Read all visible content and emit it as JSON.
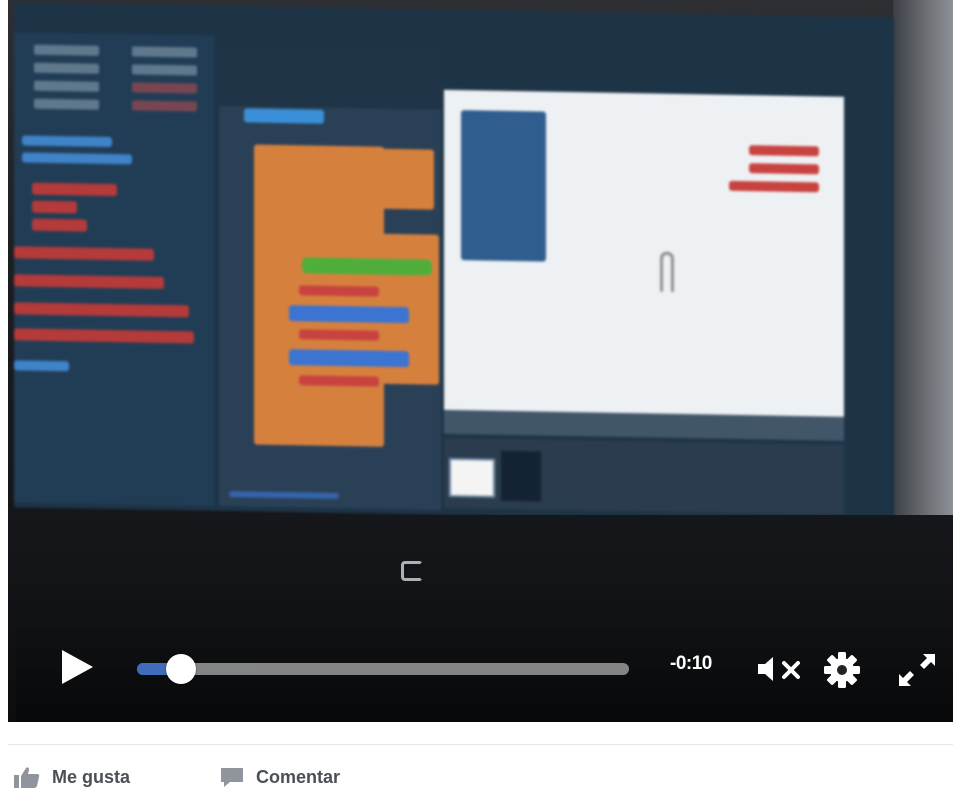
{
  "player": {
    "time_remaining": "-0:10",
    "progress_fraction": 0.09,
    "state": "paused",
    "muted": true
  },
  "actions": {
    "like_label": "Me gusta",
    "comment_label": "Comentar"
  },
  "icons": {
    "play": "play-icon",
    "volume": "muted-speaker-icon",
    "settings": "gear-icon",
    "fullscreen": "expand-arrows-icon",
    "like": "thumbs-up-icon",
    "comment": "speech-bubble-icon"
  },
  "colors": {
    "progress_fill": "#4a7ed9",
    "progress_track": "#9a9a9a",
    "action_text": "#4b4f56",
    "action_icon": "#90949c"
  }
}
